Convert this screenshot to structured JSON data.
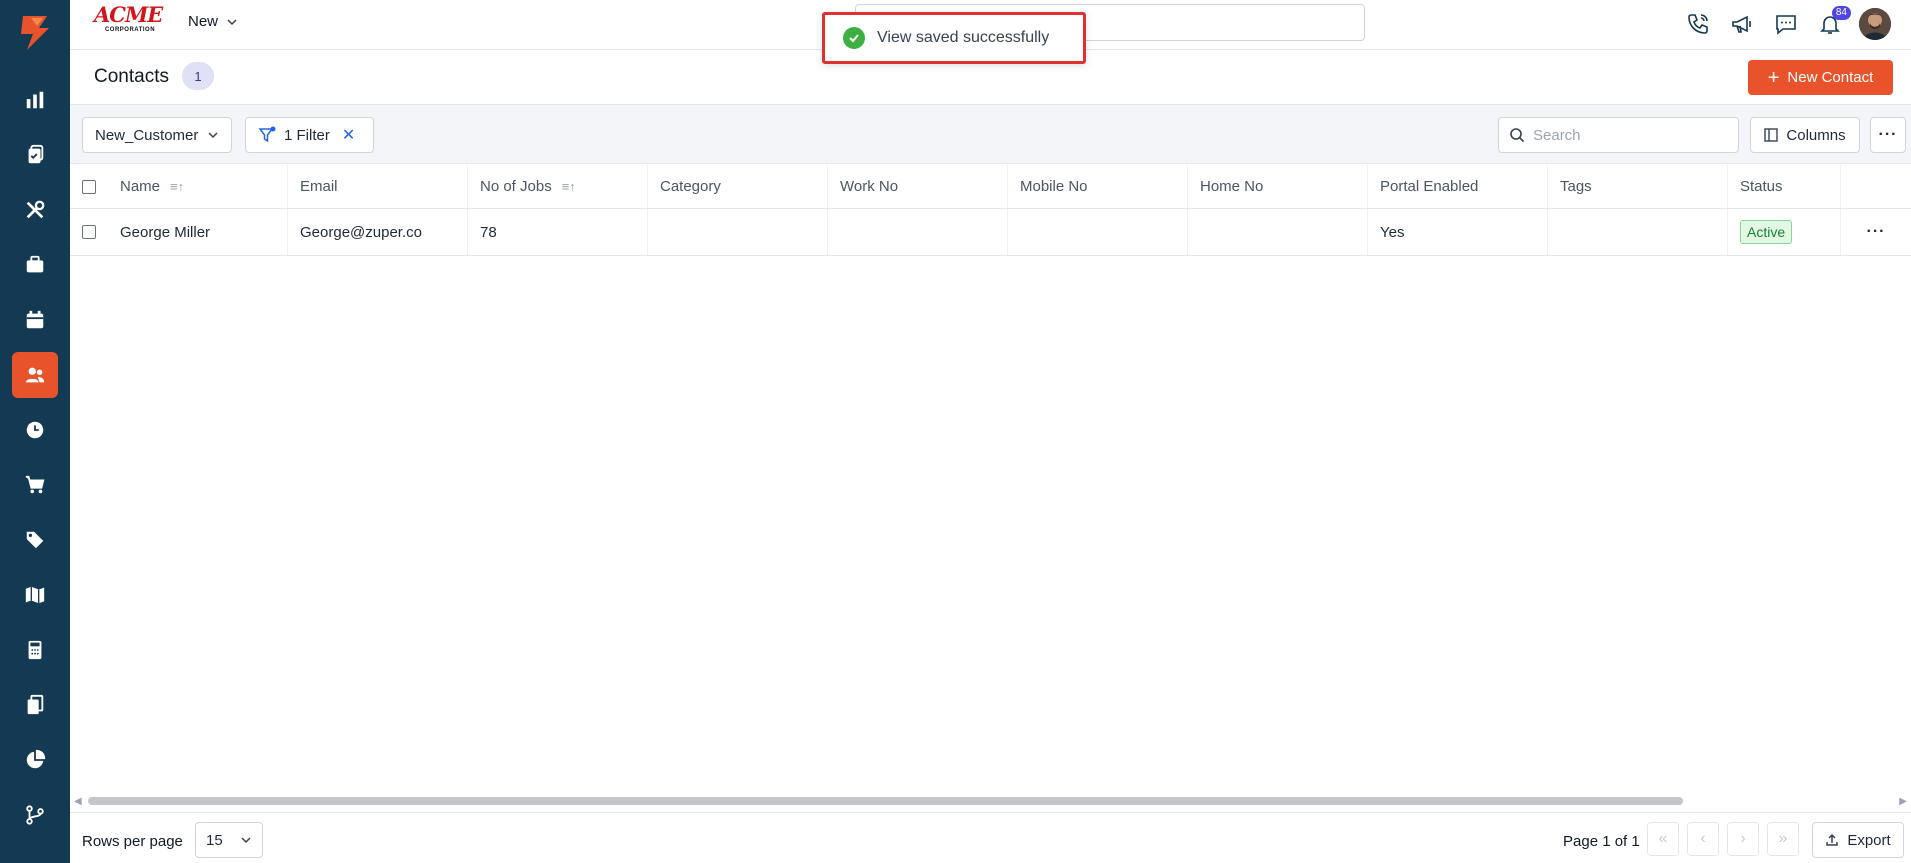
{
  "brand": {
    "name": "ACME",
    "sub": "CORPORATION"
  },
  "topbar": {
    "new_label": "New",
    "notification_count": "84"
  },
  "toast": {
    "message": "View saved successfully"
  },
  "page": {
    "title": "Contacts",
    "count": "1",
    "new_button": "New Contact"
  },
  "toolbar": {
    "view_name": "New_Customer",
    "filter_label": "1 Filter",
    "search_placeholder": "Search",
    "columns_label": "Columns"
  },
  "table": {
    "headers": {
      "name": "Name",
      "email": "Email",
      "jobs": "No of Jobs",
      "category": "Category",
      "work": "Work No",
      "mobile": "Mobile No",
      "home": "Home No",
      "portal": "Portal Enabled",
      "tags": "Tags",
      "status": "Status"
    },
    "rows": [
      {
        "name": "George Miller",
        "email": "George@zuper.co",
        "jobs": "78",
        "category": "",
        "work": "",
        "mobile": "",
        "home": "",
        "portal": "Yes",
        "tags": "",
        "status": "Active"
      }
    ]
  },
  "footer": {
    "rows_label": "Rows per page",
    "rows_value": "15",
    "page_info": "Page 1 of 1",
    "export_label": "Export"
  },
  "colors": {
    "sidebar": "#133a52",
    "accent": "#e8532b",
    "toast_border": "#e03131",
    "status_active": "#15803d"
  },
  "icons": {
    "sidebar": [
      "dashboard-icon",
      "jobs-icon",
      "tools-icon",
      "briefcase-icon",
      "calendar-icon",
      "contacts-icon",
      "clock-icon",
      "cart-icon",
      "tag-icon",
      "map-icon",
      "calculator-icon",
      "documents-icon",
      "reports-icon",
      "workflow-icon"
    ],
    "top": [
      "phone-icon",
      "megaphone-icon",
      "chat-icon",
      "bell-icon"
    ]
  }
}
